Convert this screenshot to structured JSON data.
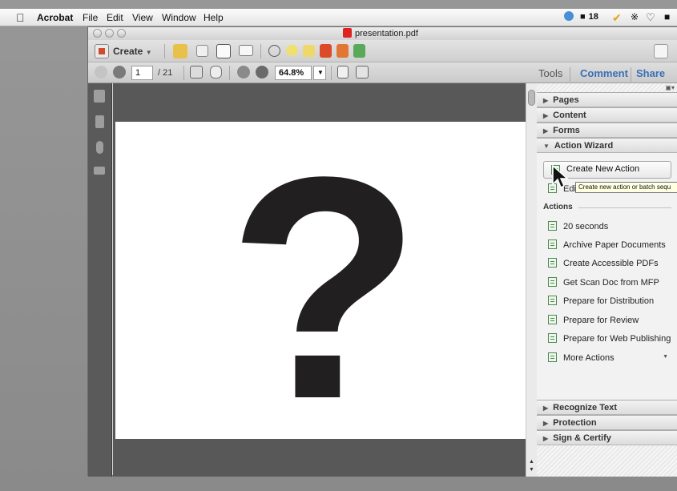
{
  "menubar": {
    "app_name": "Acrobat",
    "menus": [
      "File",
      "Edit",
      "View",
      "Window",
      "Help"
    ],
    "status": {
      "badge_count": "18"
    }
  },
  "window": {
    "title": "presentation.pdf"
  },
  "toolbar": {
    "create_label": "Create",
    "page_current": "1",
    "page_total": "/ 21",
    "zoom_value": "64.8%"
  },
  "tabs": {
    "tools": "Tools",
    "comment": "Comment",
    "share": "Share"
  },
  "panel": {
    "sections_top": [
      {
        "label": "Pages"
      },
      {
        "label": "Content"
      },
      {
        "label": "Forms"
      },
      {
        "label": "Action Wizard"
      }
    ],
    "create_new_action": "Create New Action",
    "edit_actions_partial": "Edi",
    "tooltip": "Create new action or batch sequ",
    "actions_heading": "Actions",
    "actions": [
      "20 seconds",
      "Archive Paper Documents",
      "Create Accessible PDFs",
      "Get Scan Doc from MFP",
      "Prepare for Distribution",
      "Prepare for Review",
      "Prepare for Web Publishing",
      "More Actions"
    ],
    "sections_bottom": [
      {
        "label": "Recognize Text"
      },
      {
        "label": "Protection"
      },
      {
        "label": "Sign & Certify"
      }
    ]
  },
  "document": {
    "glyph": "?"
  }
}
